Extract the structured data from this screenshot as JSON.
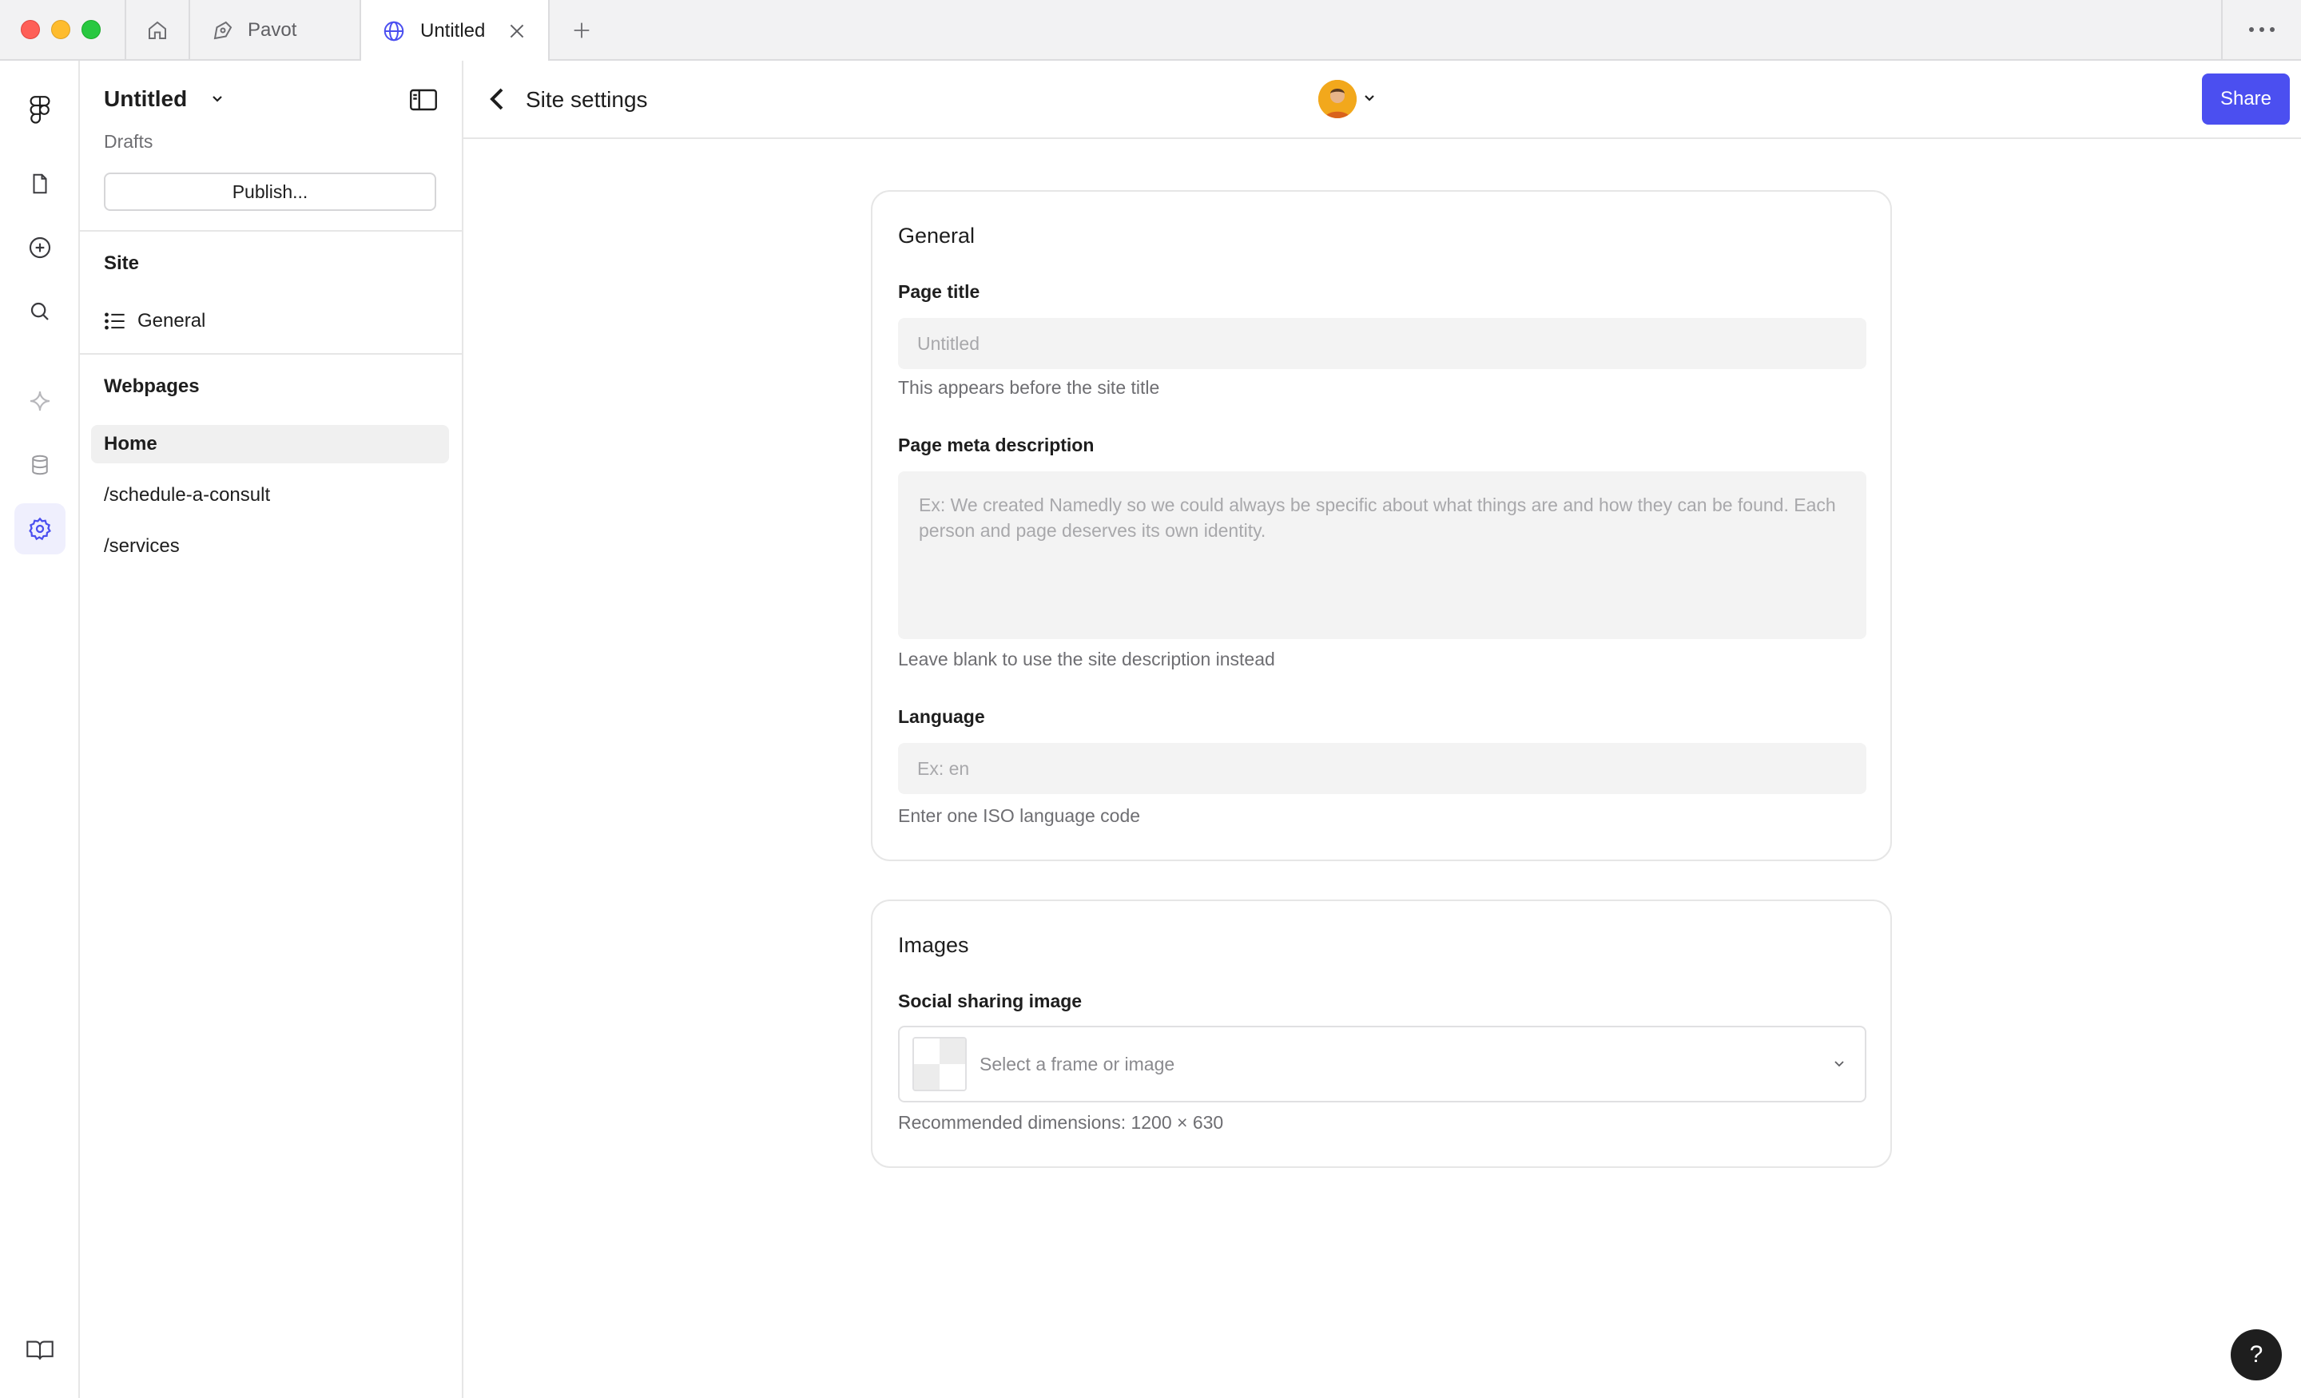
{
  "tabs": {
    "pavot": "Pavot",
    "untitled": "Untitled"
  },
  "sidebar": {
    "project_title": "Untitled",
    "location": "Drafts",
    "publish_label": "Publish...",
    "site_section": "Site",
    "site_items": [
      {
        "label": "General",
        "icon": "list-icon"
      }
    ],
    "webpages_section": "Webpages",
    "pages": [
      {
        "label": "Home",
        "active": true
      },
      {
        "label": "/schedule-a-consult",
        "active": false
      },
      {
        "label": "/services",
        "active": false
      }
    ]
  },
  "header": {
    "title": "Site settings",
    "share_label": "Share"
  },
  "general": {
    "title": "General",
    "page_title_label": "Page title",
    "page_title_placeholder": "Untitled",
    "page_title_hint": "This appears before the site title",
    "meta_label": "Page meta description",
    "meta_placeholder": "Ex: We created Namedly so we could always be specific about what things are and how they can be found. Each person and page deserves its own identity.",
    "meta_hint": "Leave blank to use the site description instead",
    "language_label": "Language",
    "language_placeholder": "Ex: en",
    "language_hint": "Enter one ISO language code"
  },
  "images": {
    "title": "Images",
    "social_label": "Social sharing image",
    "select_placeholder": "Select a frame or image",
    "dimensions_hint": "Recommended dimensions: 1200 × 630"
  },
  "help_label": "?",
  "colors": {
    "accent": "#4b4ff0",
    "active_rail_bg": "#efeffd"
  }
}
